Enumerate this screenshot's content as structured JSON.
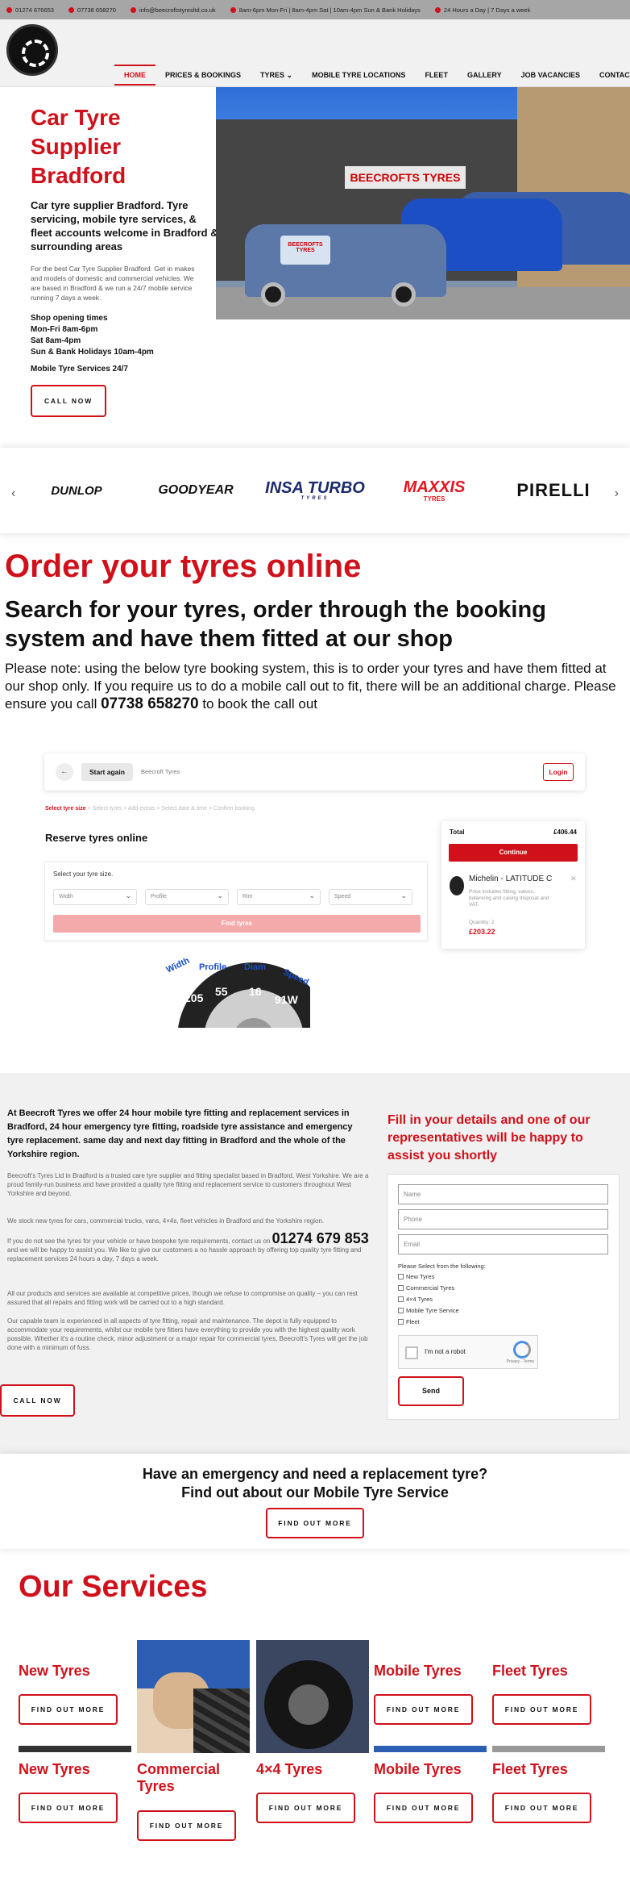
{
  "topbar": {
    "phone1": "01274 676653",
    "phone2": "07738 658270",
    "email": "info@beecroftstyresltd.co.uk",
    "hours": "8am-6pm Mon-Fri | 8am-4pm Sat | 10am-4pm Sun & Bank Holidays",
    "mobile": "24 Hours a Day | 7 Days a week"
  },
  "nav": {
    "items": [
      "HOME",
      "PRICES & BOOKINGS",
      "TYRES",
      "MOBILE TYRE LOCATIONS",
      "FLEET",
      "GALLERY",
      "JOB VACANCIES",
      "CONTACT"
    ]
  },
  "hero": {
    "title": "Car Tyre Supplier Bradford",
    "subtitle": "Car tyre supplier Bradford. Tyre servicing, mobile tyre services, & fleet accounts welcome in Bradford & surrounding areas",
    "paragraph": "For the best Car Tyre Supplier Bradford. Get in makes and models of domestic and commercial vehicles. We are based in Bradford & we run a 24/7 mobile service running 7 days a week.",
    "hours_title": "Shop opening times",
    "hours": [
      "Mon-Fri 8am-6pm",
      "Sat 8am-4pm",
      "Sun & Bank Holidays 10am-4pm"
    ],
    "mobile": "Mobile Tyre Services 24/7",
    "cta": "CALL NOW",
    "sign": "BEECROFTS TYRES",
    "van_sign": "BEECROFTS TYRES"
  },
  "brands": [
    "DUNLOP",
    "GOODYEAR",
    "INSA TURBO",
    "MAXXIS",
    "PIRELLI"
  ],
  "brand_sub": {
    "insa": "TYRES",
    "maxxis": "TYRES"
  },
  "order": {
    "title": "Order your tyres online",
    "subtitle": "Search for your tyres, order through the booking system and have them fitted at our shop",
    "note_pre": "Please note: using the below tyre booking system, this is to order your tyres and have them fitted at our shop only. If you require us to do a mobile call out to fit, there will be an additional charge. Please ensure you call",
    "note_phone": "07738 658270",
    "note_post": "to book the call out"
  },
  "widget": {
    "back": "←",
    "start": "Start again",
    "shop": "Beecroft Tyres",
    "login": "Login",
    "steps": [
      "Select tyre size",
      "Select tyres",
      "Add extras",
      "Select date & time",
      "Confirm booking"
    ],
    "reserve": "Reserve tyres online",
    "size_label": "Select your tyre size.",
    "selects": [
      "Width",
      "Profile",
      "Rim",
      "Speed"
    ],
    "find": "Find tyres",
    "cart": {
      "total_label": "Total",
      "total": "£406.44",
      "continue": "Continue",
      "item": "Michelin - LATITUDE C",
      "desc": "Price includes fitting, valves, balancing and casing disposal and VAT.",
      "qty": "Quantity: 2",
      "price": "£203.22"
    },
    "diagram": {
      "labels": [
        "Width",
        "Profile",
        "Diam",
        "Speed"
      ],
      "values": [
        "205",
        "55",
        "16",
        "91W"
      ]
    }
  },
  "about": {
    "heading": "At Beecroft Tyres we offer 24 hour mobile tyre fitting and replacement services in Bradford, 24 hour emergency tyre fitting, roadside tyre assistance and emergency tyre replacement. same day and next day fitting in Bradford and the whole of the Yorkshire region.",
    "p1": "Beecroft's Tyres Ltd in Bradford is a trusted care tyre supplier and fitting specialist based in Bradford, West Yorkshire. We are a proud family-run business and have provided a quality tyre fitting and replacement service to customers throughout West Yorkshire and beyond.",
    "p2": "We stock new tyres for cars, commercial trucks, vans, 4×4s, fleet vehicles in Bradford and the Yorkshire region.",
    "p3_pre": "If you do not see the tyres for your vehicle or have bespoke tyre requirements, contact us on",
    "p3_phone": "01274 679 853",
    "p3_post": "and we will be happy to assist you. We like to give our customers a no hassle approach by offering top quality tyre fitting and replacement services 24 hours a day, 7 days a week.",
    "p4": "All our products and services are available at competitive prices, though we refuse to compromise on quality – you can rest assured that all repairs and fitting work will be carried out to a high standard.",
    "p5": "Our capable team is experienced in all aspects of tyre fitting, repair and maintenance. The depot is fully equipped to accommodate your requirements, whilst our mobile tyre fitters have everything to provide you with the highest quality work possible. Whether it's a routine check, minor adjustment or a major repair for commercial tyres, Beecroft's Tyres will get the job done with a minimum of fuss.",
    "cta": "CALL NOW"
  },
  "form": {
    "title": "Fill in your details and one of our representatives will be happy to assist you shortly",
    "name": "Name",
    "phone": "Phone",
    "email": "Email",
    "select_label": "Please Select from the following:",
    "options": [
      "New Tyres",
      "Commercial Tyres",
      "4×4 Tyres",
      "Mobile Tyre Service",
      "Fleet"
    ],
    "captcha": "I'm not a robot",
    "captcha_brand": "reCAPTCHA",
    "captcha_terms": "Privacy - Terms",
    "send": "Send"
  },
  "emergency": {
    "line1": "Have an emergency and need a replacement tyre?",
    "line2": "Find out about our Mobile Tyre Service",
    "cta": "FIND OUT MORE"
  },
  "services": {
    "title": "Our Services",
    "row1": [
      {
        "title": "New Tyres",
        "cta": "FIND OUT MORE"
      },
      {
        "title": "",
        "cta": ""
      },
      {
        "title": "",
        "cta": ""
      },
      {
        "title": "Mobile Tyres",
        "cta": "FIND OUT MORE"
      },
      {
        "title": "Fleet Tyres",
        "cta": "FIND OUT MORE"
      }
    ],
    "row2": [
      {
        "title": "New Tyres",
        "cta": "FIND OUT MORE"
      },
      {
        "title": "Commercial Tyres",
        "cta": "FIND OUT MORE"
      },
      {
        "title": "4×4 Tyres",
        "cta": "FIND OUT MORE"
      },
      {
        "title": "Mobile Tyres",
        "cta": "FIND OUT MORE"
      },
      {
        "title": "Fleet Tyres",
        "cta": "FIND OUT MORE"
      }
    ]
  },
  "colors": {
    "brand_red": "#d0111b",
    "topbar_grey": "#a6a6a6",
    "section_grey": "#f1f1f1"
  }
}
